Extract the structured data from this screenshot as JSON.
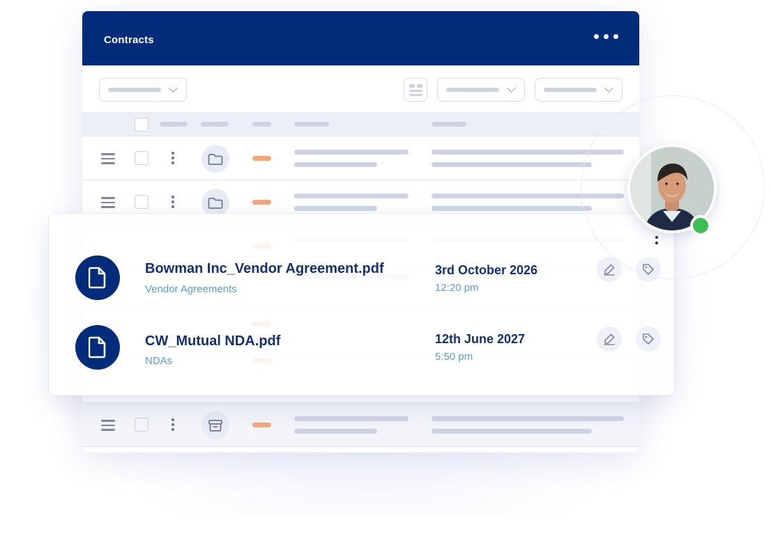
{
  "window": {
    "title": "Contracts"
  },
  "files": [
    {
      "name": "Bowman Inc_Vendor Agreement.pdf",
      "category": "Vendor Agreements",
      "date": "3rd October 2026",
      "time": "12:20 pm"
    },
    {
      "name": "CW_Mutual NDA.pdf",
      "category": "NDAs",
      "date": "12th June 2027",
      "time": "5:50 pm"
    }
  ],
  "icons": {
    "more": "more-horizontal-icon",
    "file": "file-icon",
    "edit": "pencil-icon",
    "tag": "tag-icon",
    "folder": "folder-icon",
    "archive": "archive-icon",
    "menu": "hamburger-icon",
    "kebab": "more-vertical-icon"
  },
  "colors": {
    "header": "#002c7a",
    "accent_orange": "#f5a77a",
    "online_status": "#3bbf54",
    "primary_text": "#13306f",
    "secondary_text": "#5a9bd6"
  },
  "user": {
    "status": "online"
  }
}
